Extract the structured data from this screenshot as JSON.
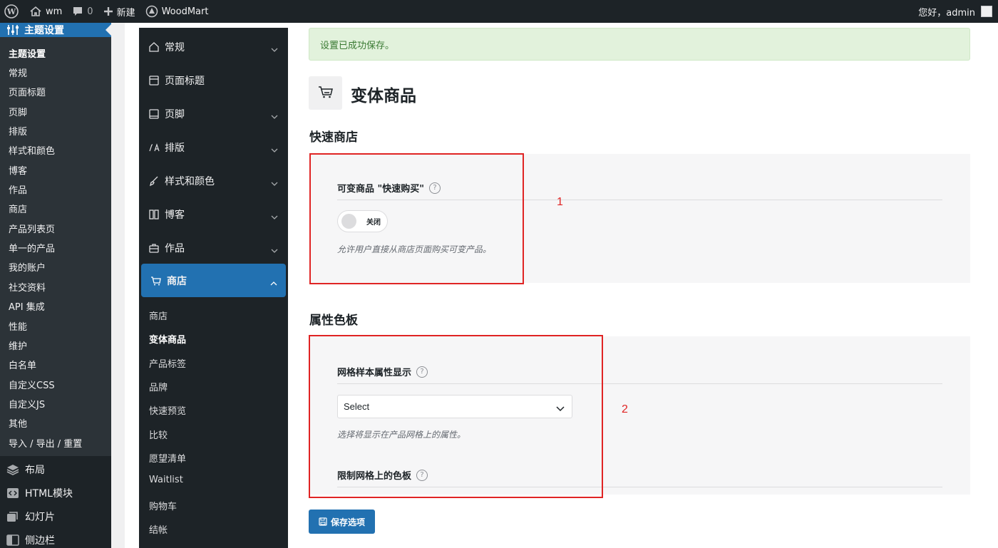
{
  "adminbar": {
    "site_name": "wm",
    "comments_count": "0",
    "new_label": "新建",
    "theme_label": "WoodMart",
    "greeting": "您好，admin"
  },
  "wp_menu": {
    "current": "主题设置",
    "submenu": [
      "主题设置",
      "常规",
      "页面标题",
      "页脚",
      "排版",
      "样式和颜色",
      "博客",
      "作品",
      "商店",
      "产品列表页",
      "单一的产品",
      "我的账户",
      "社交资料",
      "API 集成",
      "性能",
      "维护",
      "白名单",
      "自定义CSS",
      "自定义JS",
      "其他",
      "导入 / 导出 / 重置"
    ],
    "main_items": [
      {
        "label": "布局",
        "icon": "layers-icon"
      },
      {
        "label": "HTML模块",
        "icon": "code-block-icon"
      },
      {
        "label": "幻灯片",
        "icon": "slides-icon"
      },
      {
        "label": "侧边栏",
        "icon": "sidebar-icon"
      }
    ]
  },
  "options_nav": {
    "items": [
      {
        "label": "常规",
        "icon": "home-icon",
        "has_chevron": true
      },
      {
        "label": "页面标题",
        "icon": "page-title-icon",
        "has_chevron": false
      },
      {
        "label": "页脚",
        "icon": "footer-icon",
        "has_chevron": true
      },
      {
        "label": "排版",
        "icon": "typography-icon",
        "has_chevron": true
      },
      {
        "label": "样式和颜色",
        "icon": "brush-icon",
        "has_chevron": true
      },
      {
        "label": "博客",
        "icon": "blog-icon",
        "has_chevron": true
      },
      {
        "label": "作品",
        "icon": "portfolio-icon",
        "has_chevron": true
      },
      {
        "label": "商店",
        "icon": "cart-icon",
        "has_chevron": true,
        "active": true
      }
    ],
    "shop_sub": [
      "商店",
      "变体商品",
      "产品标签",
      "品牌",
      "快速预览",
      "比较",
      "愿望清单",
      "Waitlist",
      "购物车",
      "结帐"
    ],
    "shop_sub_active": "变体商品"
  },
  "main": {
    "notice": "设置已成功保存。",
    "page_title": "变体商品",
    "page_icon": "cart-icon",
    "section1": {
      "title": "快速商店",
      "field_label": "可变商品 \"快速购买\"",
      "toggle_state": "关闭",
      "description": "允许用户直接从商店页面购买可变产品。"
    },
    "section2": {
      "title": "属性色板",
      "field1_label": "网格样本属性显示",
      "select_value": "Select",
      "field1_description": "选择将显示在产品网格上的属性。",
      "field2_label": "限制网格上的色板"
    },
    "save_button": "保存选项",
    "annotations": [
      "1",
      "2"
    ]
  },
  "colors": {
    "accent": "#2271b1",
    "admin_dark": "#1d2327",
    "notice_bg": "#e2f2dc",
    "annotation_red": "#e02424"
  }
}
